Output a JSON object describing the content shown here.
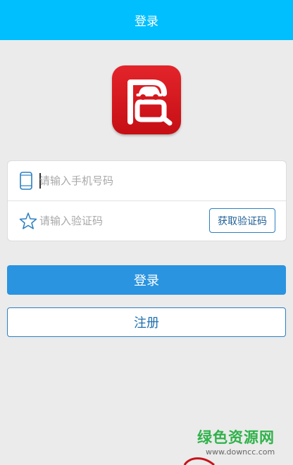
{
  "header": {
    "title": "登录"
  },
  "logo": {
    "name": "app-logo"
  },
  "form": {
    "phone_placeholder": "请输入手机号码",
    "phone_value": "",
    "code_placeholder": "请输入验证码",
    "code_value": "",
    "get_code_label": "获取验证码"
  },
  "actions": {
    "login_label": "登录",
    "register_label": "注册"
  },
  "watermark": {
    "title": "绿色资源网",
    "url": "www.downcc.com"
  },
  "colors": {
    "header": "#00bfff",
    "primary": "#2a94e0",
    "logo": "#d4171c",
    "watermark": "#2fb24a"
  },
  "icons": [
    "phone-icon",
    "star-icon"
  ]
}
